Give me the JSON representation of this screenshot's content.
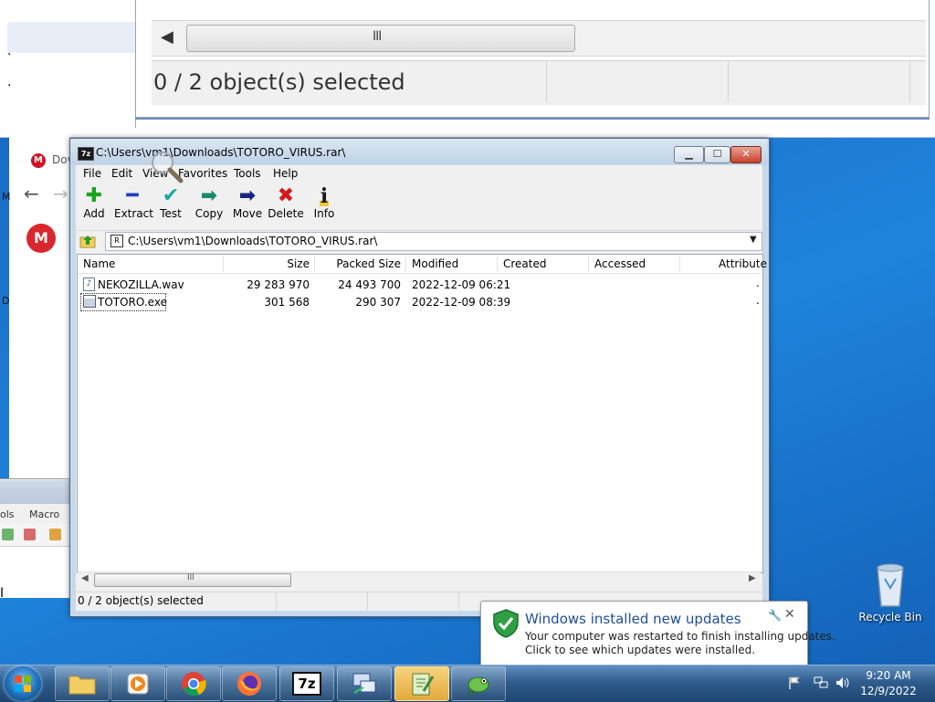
{
  "zoom_view": {
    "status_text": "0 / 2 object(s) selected",
    "scroll_grip": "III"
  },
  "browser": {
    "tab_title_partial": "Dov",
    "favicon_letter": "M",
    "logo_letter": "M",
    "edge_letters": [
      "M",
      "D"
    ]
  },
  "npp": {
    "menu_tools_partial": "ols",
    "menu_macro": "Macro",
    "cursor": "I"
  },
  "sevenzip": {
    "title": "C:\\Users\\vm1\\Downloads\\TOTORO_VIRUS.rar\\",
    "title_icon": "7z",
    "window_buttons": {
      "minimize": "▁",
      "maximize": "☐",
      "close": "✕"
    },
    "menu": [
      "File",
      "Edit",
      "View",
      "Favorites",
      "Tools",
      "Help"
    ],
    "toolbar": [
      {
        "label": "Add",
        "icon": "plus-icon",
        "color": "#1aa31a",
        "glyph": "✚"
      },
      {
        "label": "Extract",
        "icon": "minus-icon",
        "color": "#1f3fbf",
        "glyph": "━"
      },
      {
        "label": "Test",
        "icon": "check-icon",
        "color": "#1aa6a6",
        "glyph": "✔"
      },
      {
        "label": "Copy",
        "icon": "copy-arrow-icon",
        "color": "#1a8a6a",
        "glyph": "➡"
      },
      {
        "label": "Move",
        "icon": "move-arrow-icon",
        "color": "#1a237e",
        "glyph": "➡"
      },
      {
        "label": "Delete",
        "icon": "delete-x-icon",
        "color": "#d11a1a",
        "glyph": "✖"
      },
      {
        "label": "Info",
        "icon": "info-icon",
        "color": "#1a1a1a",
        "glyph": "i"
      }
    ],
    "address": "C:\\Users\\vm1\\Downloads\\TOTORO_VIRUS.rar\\",
    "columns": [
      "Name",
      "Size",
      "Packed Size",
      "Modified",
      "Created",
      "Accessed",
      "Attribute"
    ],
    "files": [
      {
        "name": "NEKOZILLA.wav",
        "size": "29 283 970",
        "packed": "24 493 700",
        "modified": "2022-12-09 06:21",
        "created": "",
        "accessed": "",
        "attr": "."
      },
      {
        "name": "TOTORO.exe",
        "size": "301 568",
        "packed": "290 307",
        "modified": "2022-12-09 08:39",
        "created": "",
        "accessed": "",
        "attr": "."
      }
    ],
    "scroll_grip": "III",
    "status_text": "0 / 2 object(s) selected"
  },
  "notification": {
    "title": "Windows installed new updates",
    "line1": "Your computer was restarted to finish installing updates.",
    "line2": "Click to see which updates were installed.",
    "close": "✕",
    "options": "🔧"
  },
  "desktop": {
    "recycle_bin_label": "Recycle Bin"
  },
  "taskbar": {
    "items": [
      {
        "name": "explorer",
        "icon": "folder-icon"
      },
      {
        "name": "media-player",
        "icon": "media-player-icon"
      },
      {
        "name": "chrome",
        "icon": "chrome-icon"
      },
      {
        "name": "firefox",
        "icon": "firefox-icon"
      },
      {
        "name": "7zip",
        "icon": "7zip-icon",
        "label": "7z"
      },
      {
        "name": "network-tool",
        "icon": "network-icon"
      },
      {
        "name": "notepad-plus-plus",
        "icon": "notepad-icon",
        "active": true
      },
      {
        "name": "game",
        "icon": "chameleon-icon"
      }
    ],
    "time": "9:20 AM",
    "date": "12/9/2022"
  }
}
